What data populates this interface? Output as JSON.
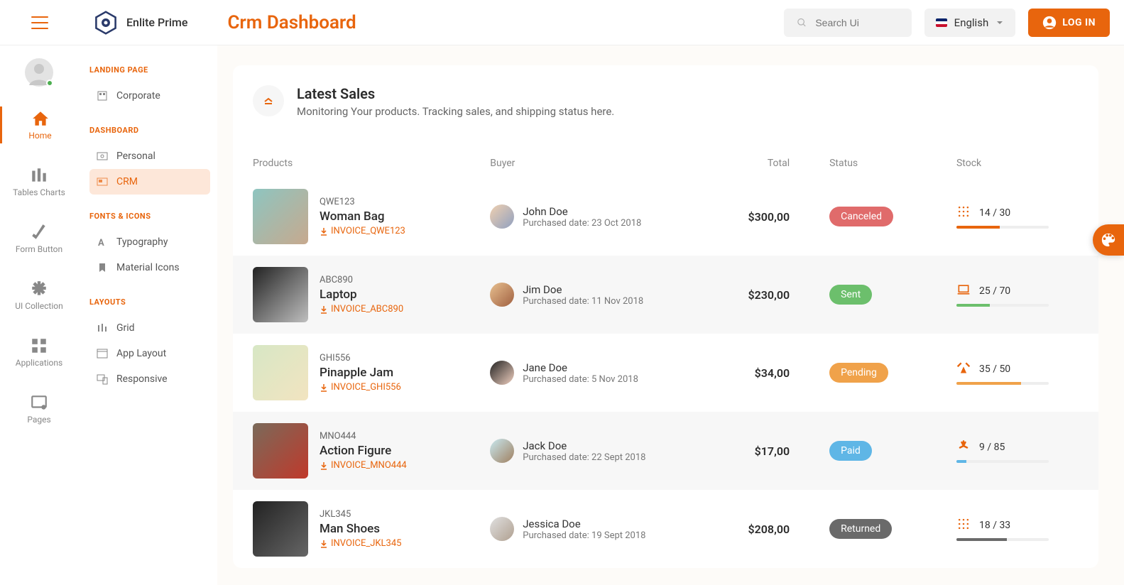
{
  "brand": "Enlite Prime",
  "page_title": "Crm Dashboard",
  "search": {
    "placeholder": "Search Ui"
  },
  "language": "English",
  "login": "LOG IN",
  "rail": {
    "home": "Home",
    "tables": "Tables Charts",
    "form": "Form Button",
    "ui": "UI Collection",
    "apps": "Applications",
    "pages": "Pages"
  },
  "submenu": {
    "s1": "LANDING PAGE",
    "i1": "Corporate",
    "s2": "DASHBOARD",
    "i2": "Personal",
    "i3": "CRM",
    "s3": "FONTS & ICONS",
    "i4": "Typography",
    "i5": "Material Icons",
    "s4": "LAYOUTS",
    "i6": "Grid",
    "i7": "App Layout",
    "i8": "Responsive"
  },
  "card": {
    "title": "Latest Sales",
    "subtitle": "Monitoring Your products. Tracking sales, and shipping status here."
  },
  "columns": {
    "products": "Products",
    "buyer": "Buyer",
    "total": "Total",
    "status": "Status",
    "stock": "Stock"
  },
  "purchased_prefix": "Purchased date: ",
  "rows": [
    {
      "sku": "QWE123",
      "name": "Woman Bag",
      "invoice": "INVOICE_QWE123",
      "buyer": "John Doe",
      "date": "23 Oct 2018",
      "total": "$300,00",
      "status": "Canceled",
      "status_class": "st-canceled",
      "stock": "14 / 30",
      "pct": 47,
      "pb": "",
      "img": "p1",
      "ava": "b1",
      "stock_icon": "grid"
    },
    {
      "sku": "ABC890",
      "name": "Laptop",
      "invoice": "INVOICE_ABC890",
      "buyer": "Jim Doe",
      "date": "11 Nov 2018",
      "total": "$230,00",
      "status": "Sent",
      "status_class": "st-sent",
      "stock": "25 / 70",
      "pct": 36,
      "pb": "pb-sent",
      "img": "p2",
      "ava": "b2",
      "stock_icon": "laptop"
    },
    {
      "sku": "GHI556",
      "name": "Pinapple Jam",
      "invoice": "INVOICE_GHI556",
      "buyer": "Jane Doe",
      "date": "5 Nov 2018",
      "total": "$34,00",
      "status": "Pending",
      "status_class": "st-pending",
      "stock": "35 / 50",
      "pct": 70,
      "pb": "pb-pend",
      "img": "p3",
      "ava": "b3",
      "stock_icon": "food"
    },
    {
      "sku": "MNO444",
      "name": "Action Figure",
      "invoice": "INVOICE_MNO444",
      "buyer": "Jack Doe",
      "date": "22 Sept 2018",
      "total": "$17,00",
      "status": "Paid",
      "status_class": "st-paid",
      "stock": "9 / 85",
      "pct": 11,
      "pb": "pb-paid",
      "img": "p4",
      "ava": "b4",
      "stock_icon": "toy"
    },
    {
      "sku": "JKL345",
      "name": "Man Shoes",
      "invoice": "INVOICE_JKL345",
      "buyer": "Jessica Doe",
      "date": "19 Sept 2018",
      "total": "$208,00",
      "status": "Returned",
      "status_class": "st-returned",
      "stock": "18 / 33",
      "pct": 55,
      "pb": "pb-ret",
      "img": "p5",
      "ava": "b5",
      "stock_icon": "grid"
    }
  ]
}
